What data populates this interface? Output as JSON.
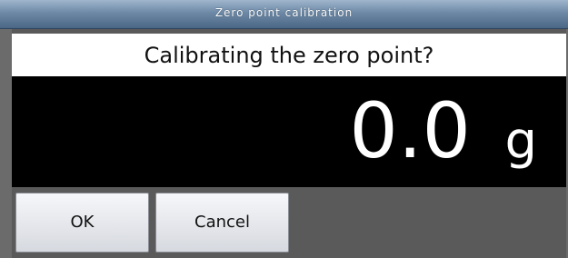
{
  "window": {
    "title": "Zero point calibration"
  },
  "dialog": {
    "prompt": "Calibrating the zero point?",
    "display_value": "0.0",
    "display_unit": "g"
  },
  "buttons": {
    "ok_label": "OK",
    "cancel_label": "Cancel"
  },
  "colors": {
    "titlebar_accent": "#5f7c9a",
    "display_background": "#000000",
    "display_text": "#ffffff",
    "prompt_background": "#ffffff",
    "frame_background": "#5a5a5a"
  }
}
